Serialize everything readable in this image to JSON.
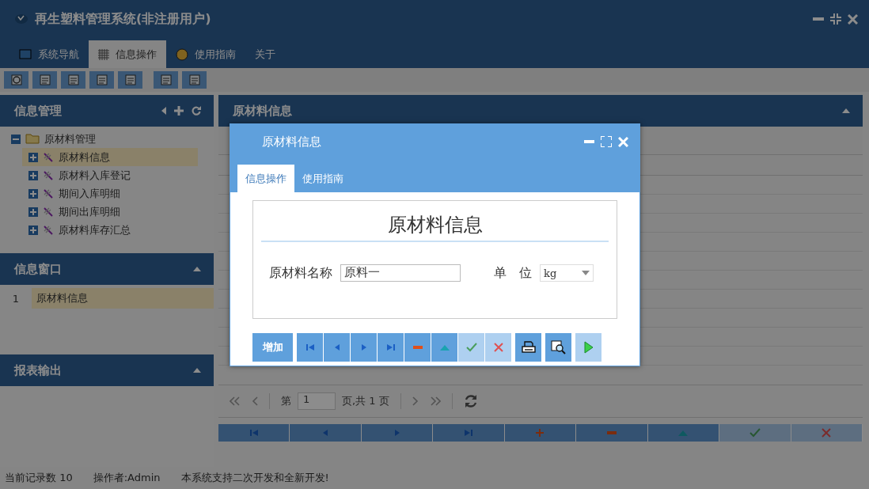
{
  "window": {
    "title": "再生塑料管理系统(非注册用户)"
  },
  "menu_tabs": [
    {
      "label": "系统导航",
      "selected": false,
      "kind": "monitor"
    },
    {
      "label": "信息操作",
      "selected": true,
      "kind": "grid"
    },
    {
      "label": "使用指南",
      "selected": false,
      "kind": "help"
    },
    {
      "label": "关于",
      "selected": false,
      "kind": "none"
    }
  ],
  "sidebar": [
    {
      "title": "信息管理",
      "kind": "tree",
      "tree": [
        {
          "label": "原材料管理",
          "expanded": true,
          "children": [
            {
              "label": "原材料信息",
              "selected": true
            },
            {
              "label": "原材料入库登记",
              "selected": false
            },
            {
              "label": "期间入库明细",
              "selected": false
            },
            {
              "label": "期间出库明细",
              "selected": false
            },
            {
              "label": "原材料库存汇总",
              "selected": false
            }
          ]
        }
      ]
    },
    {
      "title": "信息窗口",
      "kind": "list",
      "rows": [
        {
          "index": "1",
          "label": "原材料信息",
          "selected": true
        }
      ]
    },
    {
      "title": "报表输出",
      "kind": "empty"
    }
  ],
  "main_panel": {
    "title": "原材料信息",
    "pager": {
      "page_label": "第",
      "page_value": "1",
      "total_label": "页,共 1 页"
    },
    "nav_buttons": [
      {
        "kind": "first",
        "disabled": false
      },
      {
        "kind": "prev",
        "disabled": false
      },
      {
        "kind": "next",
        "disabled": false
      },
      {
        "kind": "last",
        "disabled": false
      },
      {
        "kind": "add",
        "disabled": false
      },
      {
        "kind": "delete",
        "disabled": false
      },
      {
        "kind": "up",
        "disabled": false
      },
      {
        "kind": "confirm",
        "disabled": true
      },
      {
        "kind": "cancel",
        "disabled": true
      }
    ]
  },
  "status_bar": [
    "当前记录数 10",
    "操作者:Admin",
    "本系统支持二次开发和全新开发!"
  ],
  "dialog": {
    "title": "原材料信息",
    "tabs": [
      {
        "label": "信息操作",
        "selected": true
      },
      {
        "label": "使用指南",
        "selected": false
      }
    ],
    "form_title": "原材料信息",
    "fields": [
      {
        "kind": "text",
        "label": "原材料名称",
        "value": "原料一"
      },
      {
        "kind": "select",
        "label": "单　位",
        "value": "kg"
      }
    ],
    "buttons": [
      {
        "kind": "text",
        "label": "增加",
        "disabled": false
      },
      {
        "kind": "first",
        "disabled": false
      },
      {
        "kind": "prev",
        "disabled": false
      },
      {
        "kind": "next",
        "disabled": false
      },
      {
        "kind": "last",
        "disabled": false
      },
      {
        "kind": "delete",
        "disabled": false
      },
      {
        "kind": "up",
        "disabled": false
      },
      {
        "kind": "confirm",
        "disabled": true
      },
      {
        "kind": "cancel",
        "disabled": true
      },
      {
        "kind": "print",
        "disabled": false
      },
      {
        "kind": "preview",
        "disabled": false
      },
      {
        "kind": "run",
        "disabled": true
      }
    ]
  }
}
